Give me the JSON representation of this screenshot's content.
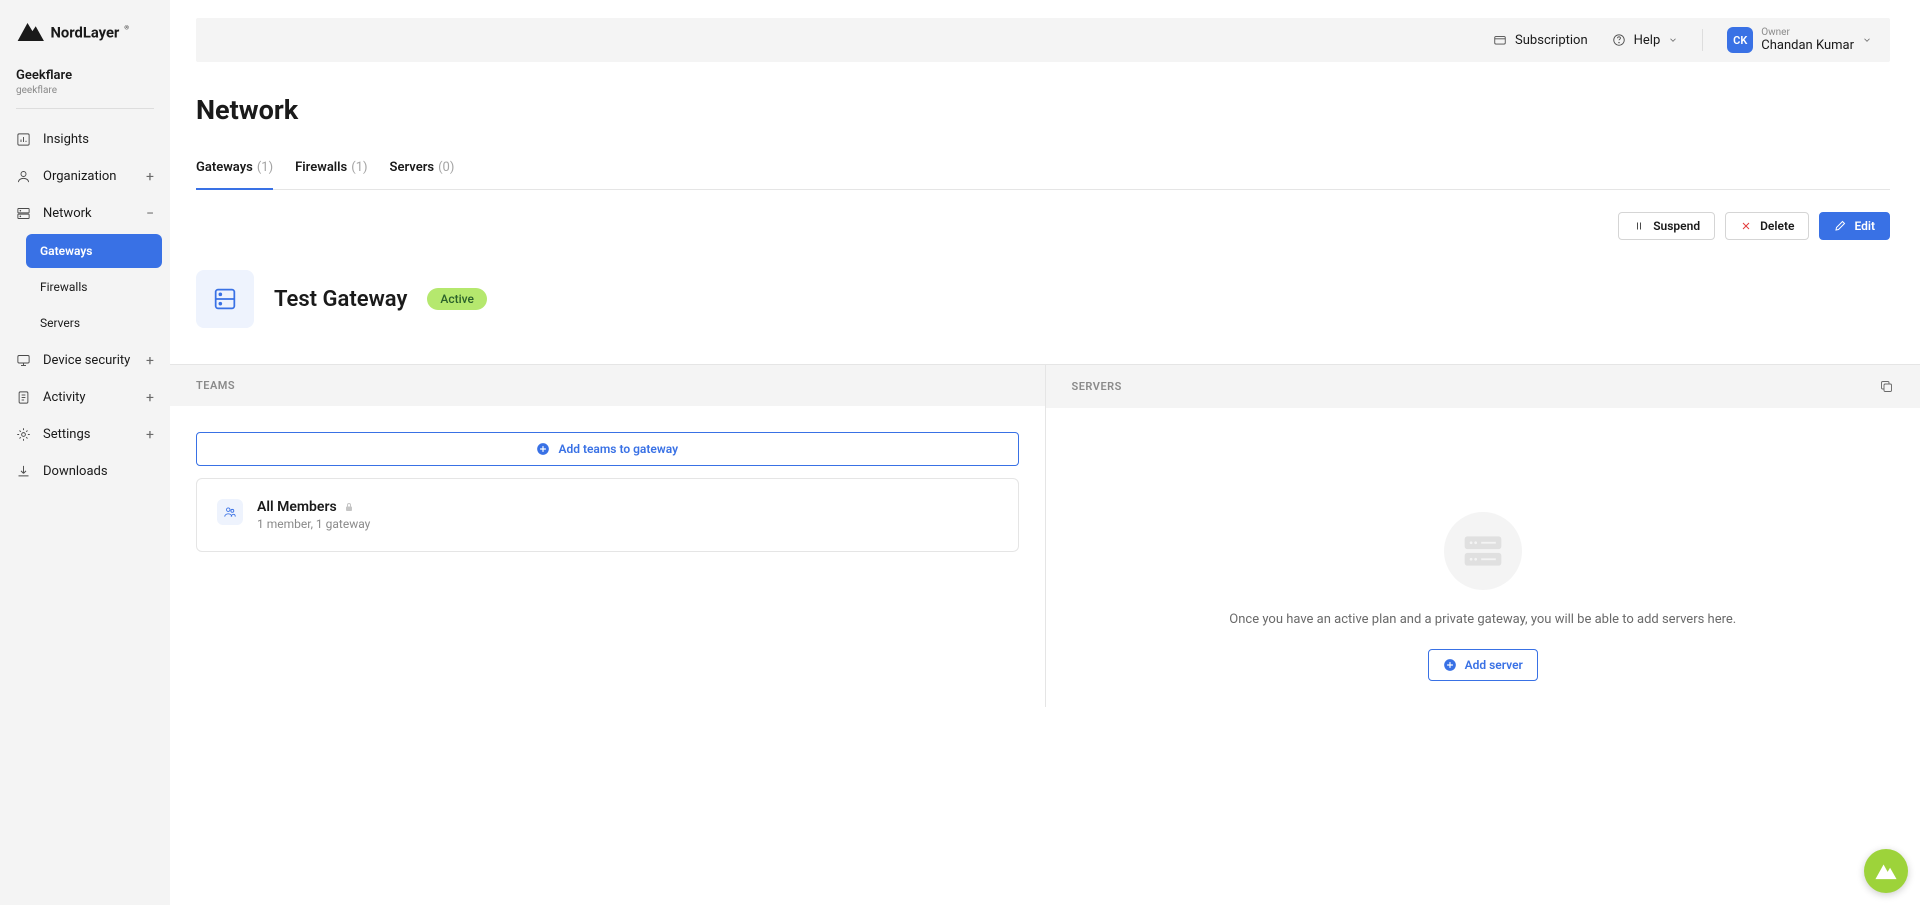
{
  "brand": "NordLayer",
  "org": {
    "name": "Geekflare",
    "slug": "geekflare"
  },
  "nav": {
    "insights": "Insights",
    "organization": "Organization",
    "network": "Network",
    "device_security": "Device security",
    "activity": "Activity",
    "settings": "Settings",
    "downloads": "Downloads",
    "sub": {
      "gateways": "Gateways",
      "firewalls": "Firewalls",
      "servers": "Servers"
    }
  },
  "topbar": {
    "subscription": "Subscription",
    "help": "Help",
    "user": {
      "initials": "CK",
      "role": "Owner",
      "name": "Chandan Kumar"
    }
  },
  "page": {
    "title": "Network"
  },
  "tabs": {
    "gateways": {
      "label": "Gateways",
      "count": "(1)"
    },
    "firewalls": {
      "label": "Firewalls",
      "count": "(1)"
    },
    "servers": {
      "label": "Servers",
      "count": "(0)"
    }
  },
  "actions": {
    "suspend": "Suspend",
    "delete": "Delete",
    "edit": "Edit"
  },
  "gateway": {
    "name": "Test Gateway",
    "status": "Active"
  },
  "panels": {
    "teams": {
      "title": "TEAMS",
      "add_btn": "Add teams to gateway",
      "team": {
        "name": "All Members",
        "meta": "1 member, 1 gateway"
      }
    },
    "servers": {
      "title": "SERVERS",
      "empty": "Once you have an active plan and a private gateway, you will be able to add servers here.",
      "add_btn": "Add server"
    }
  }
}
